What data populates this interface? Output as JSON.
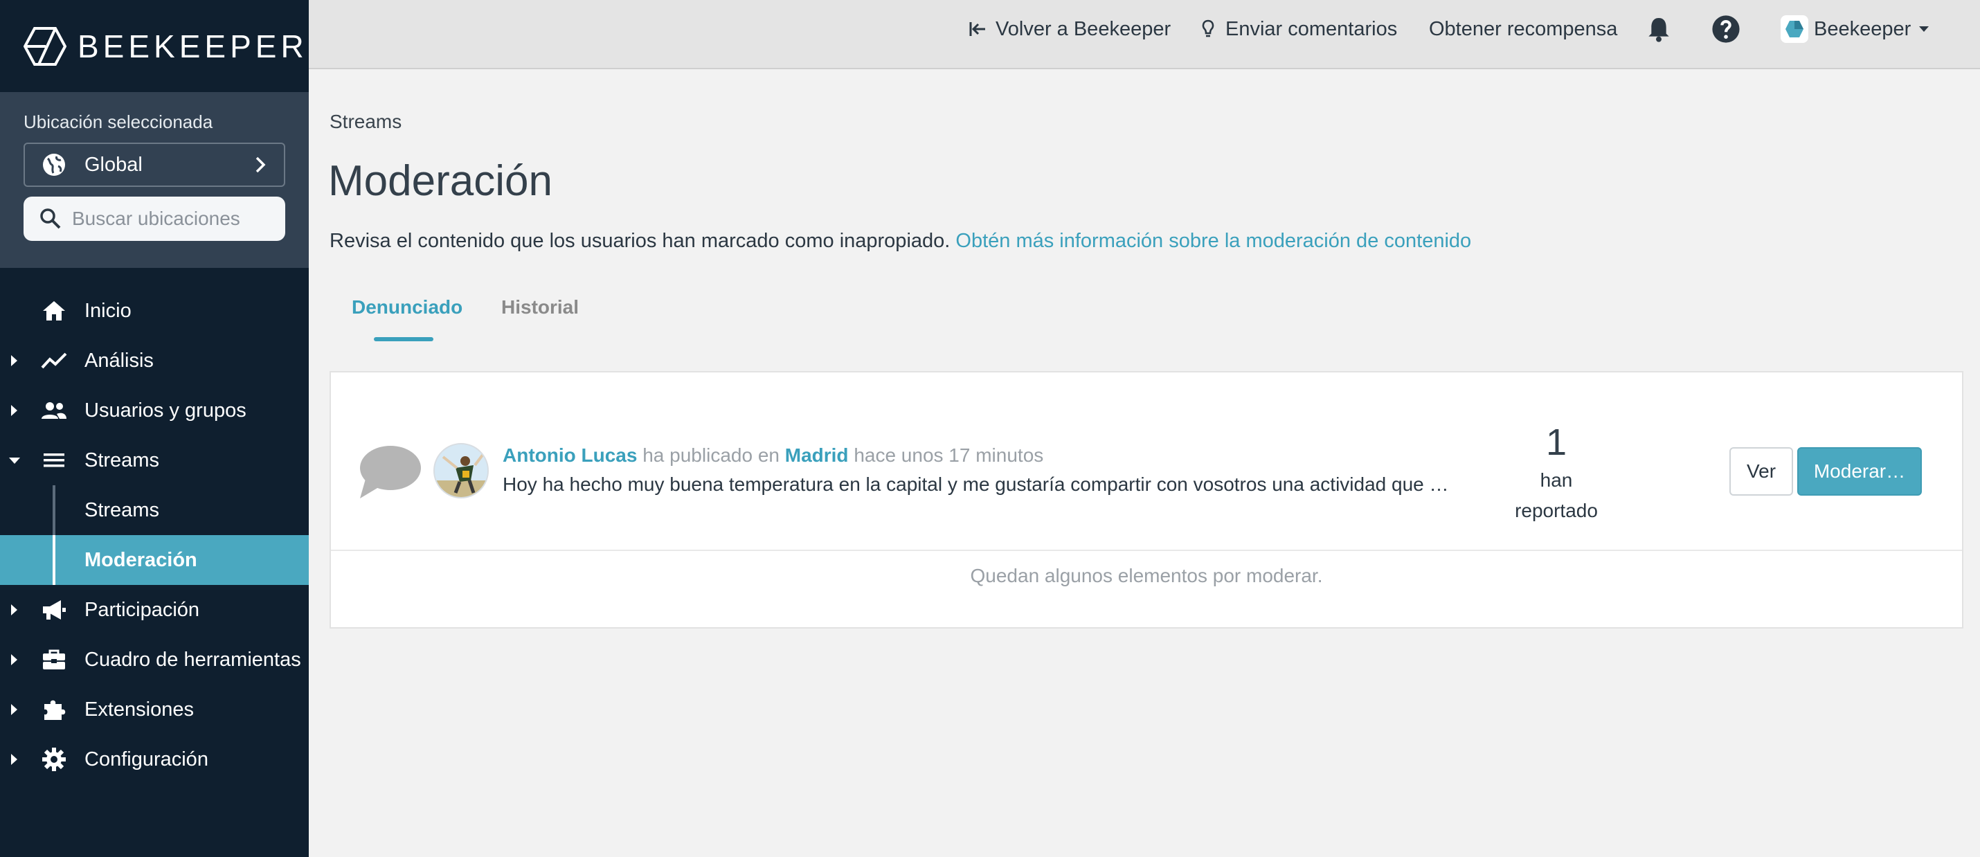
{
  "brand": {
    "name": "BEEKEEPER"
  },
  "location": {
    "label": "Ubicación seleccionada",
    "selected": "Global",
    "search_placeholder": "Buscar ubicaciones"
  },
  "nav": {
    "home": "Inicio",
    "analytics": "Análisis",
    "users": "Usuarios y grupos",
    "streams": "Streams",
    "streams_sub": "Streams",
    "moderation_sub": "Moderación",
    "engagement": "Participación",
    "toolbox": "Cuadro de herramientas",
    "extensions": "Extensiones",
    "settings": "Configuración"
  },
  "topbar": {
    "back": "Volver a Beekeeper",
    "feedback": "Enviar comentarios",
    "reward": "Obtener recompensa",
    "account": "Beekeeper"
  },
  "main": {
    "breadcrumb": "Streams",
    "title": "Moderación",
    "description": "Revisa el contenido que los usuarios han marcado como inapropiado.",
    "learn_more": "Obtén más información sobre la moderación de contenido",
    "tabs": {
      "reported": "Denunciado",
      "history": "Historial"
    }
  },
  "report": {
    "author": "Antonio Lucas",
    "posted_in": "ha publicado en",
    "stream": "Madrid",
    "time": "hace unos 17 minutos",
    "text": "Hoy ha hecho muy buena temperatura en la capital y me gustaría compartir con vosotros una actividad que …",
    "count": "1",
    "count_label_1": "han",
    "count_label_2": "reportado",
    "view_button": "Ver",
    "moderate_button": "Moderar…",
    "footer": "Quedan algunos elementos por moderar."
  },
  "colors": {
    "accent": "#4aa8c0",
    "sidebar": "#0f1f2f",
    "location_panel": "#324152"
  }
}
